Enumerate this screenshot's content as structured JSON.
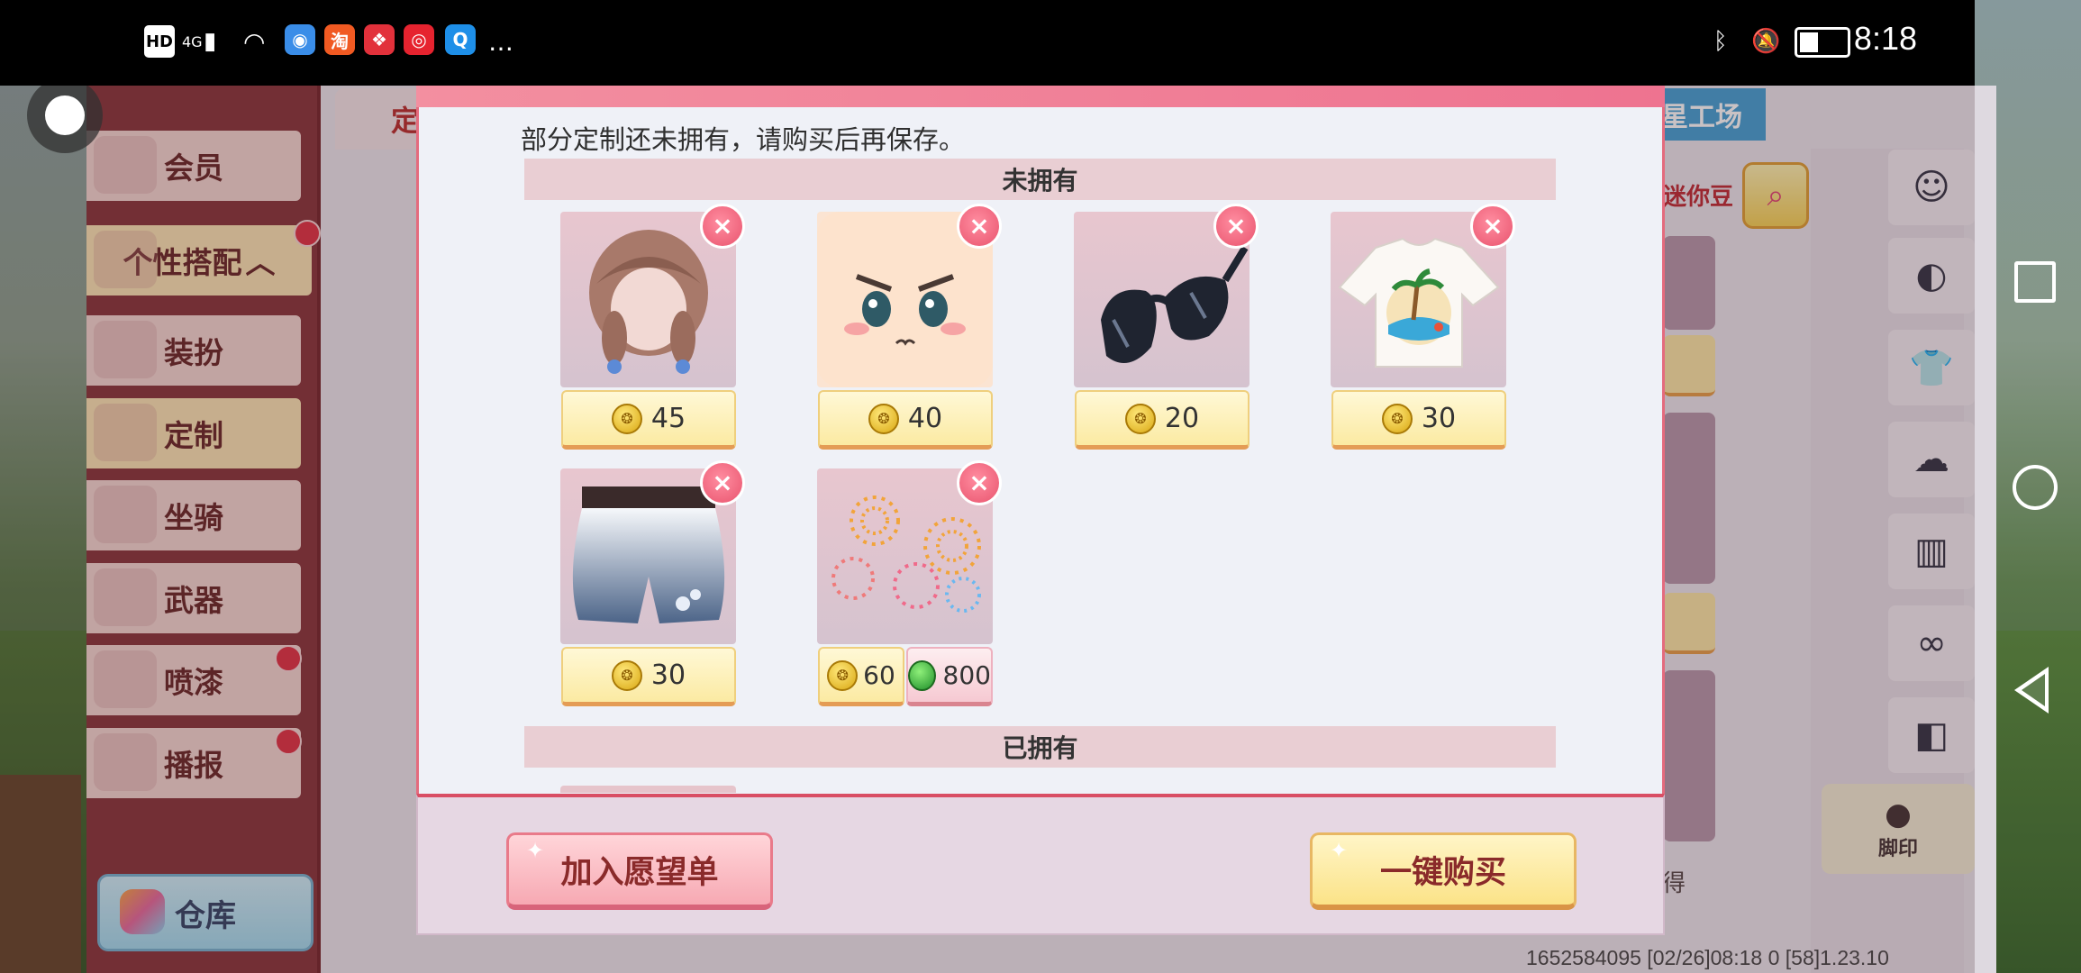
{
  "status_bar": {
    "left_labels": [
      "HD",
      "4G",
      "…"
    ],
    "time": "8:18"
  },
  "side_menu": {
    "items": [
      {
        "label": "会员",
        "active": false
      },
      {
        "label": "个性搭配",
        "active": true,
        "has_dot": true
      },
      {
        "label": "装扮",
        "active": false
      },
      {
        "label": "定制",
        "active": true
      },
      {
        "label": "坐骑",
        "active": false
      },
      {
        "label": "武器",
        "active": false
      },
      {
        "label": "喷漆",
        "active": false,
        "has_dot": true
      },
      {
        "label": "播报",
        "active": false,
        "has_dot": true
      }
    ],
    "warehouse": "仓库"
  },
  "background": {
    "tab_left": "定",
    "tab_right": "星工场",
    "bean_label": "迷你豆",
    "footprint_label": "脚印",
    "bottom_short": "得",
    "bottom_code": "1652584095 [02/26]08:18 0 [58]1.23.10",
    "categories": [
      "face-icon",
      "mask-icon",
      "shirt-icon",
      "hair-icon",
      "pants-icon",
      "shoes-icon",
      "backpack-icon"
    ]
  },
  "modal": {
    "notice": "部分定制还未拥有，请购买后再保存。",
    "section_not_owned": "未拥有",
    "section_owned": "已拥有",
    "items": [
      {
        "name": "braided-hair",
        "price_coin": "45"
      },
      {
        "name": "angry-face",
        "price_coin": "40"
      },
      {
        "name": "sunglasses",
        "price_coin": "20"
      },
      {
        "name": "palm-tree-tshirt",
        "price_coin": "30"
      },
      {
        "name": "blue-shorts",
        "price_coin": "30"
      },
      {
        "name": "fireworks-effect",
        "price_coin": "60",
        "price_gem": "800"
      }
    ],
    "wishlist_button": "加入愿望单",
    "buy_button": "一键购买",
    "remove_glyph": "×"
  }
}
